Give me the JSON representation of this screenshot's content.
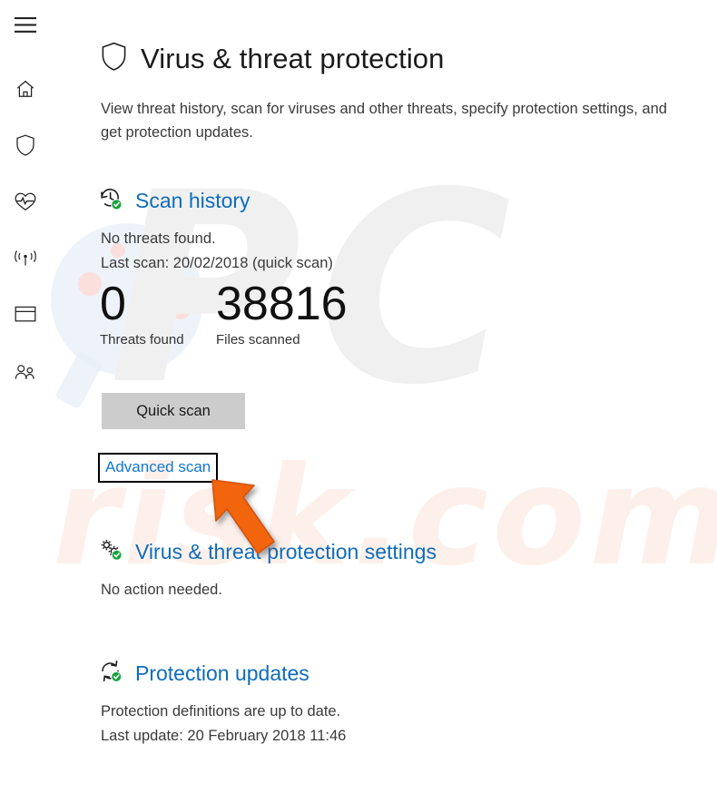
{
  "app": {
    "title": "Virus & threat protection",
    "description": "View threat history, scan for viruses and other threats, specify protection settings, and get protection updates.",
    "accent_blue": "#0f6cbd",
    "link_blue": "#1178d4",
    "badge_green": "#14a33c",
    "button_gray": "#cccccc",
    "arrow_orange": "#f2650a"
  },
  "sidebar": {
    "items": [
      {
        "name": "hamburger-menu",
        "label": "Menu",
        "icon": "hamburger-icon"
      },
      {
        "name": "home",
        "label": "Home",
        "icon": "home-icon"
      },
      {
        "name": "virus-threat-protection",
        "label": "Virus & threat protection",
        "icon": "shield-icon"
      },
      {
        "name": "device-performance-health",
        "label": "Device performance & health",
        "icon": "heart-pulse-icon"
      },
      {
        "name": "firewall-network-protection",
        "label": "Firewall & network protection",
        "icon": "wifi-signal-icon"
      },
      {
        "name": "app-browser-control",
        "label": "App & browser control",
        "icon": "browser-window-icon"
      },
      {
        "name": "family-options",
        "label": "Family options",
        "icon": "people-icon"
      }
    ]
  },
  "header": {
    "title": "Virus & threat protection",
    "shield_icon": "shield-outline-icon"
  },
  "sections": {
    "scan_history": {
      "title": "Scan history",
      "icon": "history-clock-check-icon",
      "status": "No threats found.",
      "last_scan": "Last scan: 20/02/2018 (quick scan)",
      "stats": [
        {
          "value": "0",
          "label": "Threats found"
        },
        {
          "value": "38816",
          "label": "Files scanned"
        }
      ],
      "quick_scan_button": "Quick scan",
      "advanced_scan_link": "Advanced scan"
    },
    "protection_settings": {
      "title": "Virus & threat protection settings",
      "icon": "gears-check-icon",
      "status": "No action needed."
    },
    "protection_updates": {
      "title": "Protection updates",
      "icon": "refresh-check-icon",
      "status": "Protection definitions are up to date.",
      "last_update": "Last update: 20 February 2018 11:46"
    }
  },
  "watermark": {
    "primary": "PC",
    "secondary": "risk.com"
  }
}
